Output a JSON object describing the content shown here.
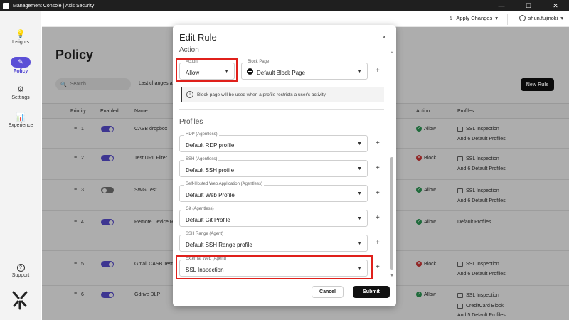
{
  "window": {
    "title": "Management Console | Axis Security",
    "minimize": "—",
    "maximize": "☐",
    "close": "✕"
  },
  "sidebar": {
    "items": [
      {
        "label": "Insights",
        "icon": "lightbulb-icon"
      },
      {
        "label": "Policy",
        "icon": "policy-icon"
      },
      {
        "label": "Settings",
        "icon": "gear-icon"
      },
      {
        "label": "Experience",
        "icon": "bar-chart-icon"
      }
    ],
    "support_label": "Support",
    "accent": "#5b4fd6"
  },
  "header": {
    "apply_label": "Apply Changes",
    "user": "shun.fujinoki"
  },
  "page": {
    "title": "Policy",
    "search_placeholder": "Search...",
    "last_changes": "Last changes a",
    "new_rule": "New Rule"
  },
  "table": {
    "headers": {
      "priority": "Priority",
      "enabled": "Enabled",
      "name": "Name",
      "action": "Action",
      "profiles": "Profiles"
    },
    "rows": [
      {
        "priority": "1",
        "enabled": true,
        "name": "CASB dropbox",
        "action": "Allow",
        "profiles": [
          "SSL Inspection",
          "And 6 Default Profiles"
        ]
      },
      {
        "priority": "2",
        "enabled": true,
        "name": "Test URL Filter",
        "action": "Block",
        "profiles": [
          "SSL Inspection",
          "And 6 Default Profiles"
        ]
      },
      {
        "priority": "3",
        "enabled": false,
        "name": "SWG Test",
        "action": "Allow",
        "profiles": [
          "SSL Inspection",
          "And 6 Default Profiles"
        ]
      },
      {
        "priority": "4",
        "enabled": true,
        "name": "Remote Device R",
        "action": "Allow",
        "profiles": [
          "Default Profiles"
        ]
      },
      {
        "priority": "5",
        "enabled": true,
        "name": "Gmail CASB Test",
        "action": "Block",
        "profiles": [
          "SSL Inspection",
          "And 6 Default Profiles"
        ]
      },
      {
        "priority": "6",
        "enabled": true,
        "name": "Gdrive DLP",
        "action": "Allow",
        "profiles": [
          "SSL Inspection",
          "CreditCard Block",
          "And 5 Default Profiles"
        ]
      }
    ]
  },
  "modal": {
    "title": "Edit Rule",
    "close": "×",
    "action_section": "Action",
    "action_field": {
      "label": "Action",
      "value": "Allow"
    },
    "block_page_field": {
      "label": "Block Page",
      "value": "Default Block Page"
    },
    "info_text": "Block page will be used when a profile restricts a user's activity",
    "profiles_section": "Profiles",
    "profiles": [
      {
        "label": "RDP (Agentless)",
        "value": "Default RDP profile"
      },
      {
        "label": "SSH (Agentless)",
        "value": "Default SSH profile"
      },
      {
        "label": "Self-Hosted Web Application (Agentless)",
        "value": "Default Web Profile"
      },
      {
        "label": "Git (Agentless)",
        "value": "Default Git Profile"
      },
      {
        "label": "SSH Range (Agent)",
        "value": "Default SSH Range profile"
      },
      {
        "label": "External Web (Agent)",
        "value": "SSL Inspection"
      }
    ],
    "cancel": "Cancel",
    "submit": "Submit"
  }
}
